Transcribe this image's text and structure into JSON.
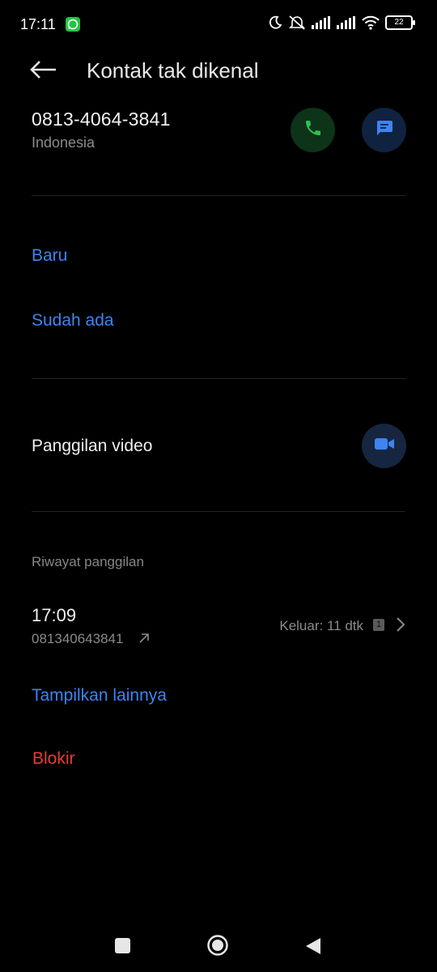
{
  "status_bar": {
    "time": "17:11",
    "battery": "22",
    "icons": [
      "whatsapp-icon",
      "moon-icon",
      "bell-off-icon",
      "signal-icon",
      "signal-icon",
      "wifi-icon",
      "battery-icon"
    ]
  },
  "header": {
    "title": "Kontak tak dikenal"
  },
  "contact": {
    "number": "0813-4064-3841",
    "country": "Indonesia"
  },
  "add_contact": {
    "new_label": "Baru",
    "existing_label": "Sudah ada"
  },
  "video_call": {
    "label": "Panggilan video"
  },
  "call_history": {
    "section_label": "Riwayat panggilan",
    "entries": [
      {
        "time": "17:09",
        "number": "081340643841",
        "detail": "Keluar: 11 dtk",
        "sim": "1"
      }
    ],
    "show_more_label": "Tampilkan lainnya"
  },
  "block": {
    "label": "Blokir"
  },
  "colors": {
    "accent_blue": "#3d84f2",
    "call_green": "#2fbf55",
    "danger_red": "#e83b36"
  }
}
